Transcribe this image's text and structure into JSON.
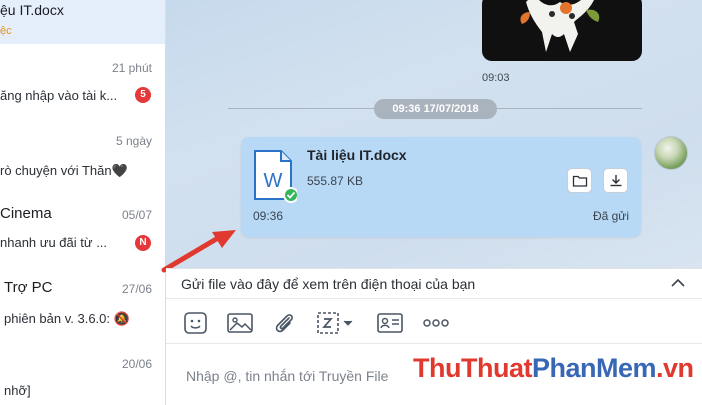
{
  "conversations": [
    {
      "name": "",
      "time": "",
      "preview": "ệu IT.docx",
      "sub": "ệc",
      "badge": ""
    },
    {
      "name": "",
      "time": "21 phút",
      "preview": "ăng nhập vào tài k...",
      "sub": "",
      "badge": "5"
    },
    {
      "name": "",
      "time": "5 ngày",
      "preview": "rò chuyện với Thăn🖤",
      "sub": "",
      "badge": ""
    },
    {
      "name": "Cinema",
      "time": "05/07",
      "preview": "nhanh ưu đãi từ ...",
      "sub": "",
      "badge": "N"
    },
    {
      "name": "Trợ PC",
      "time": "27/06",
      "preview": "phiên bản v. 3.6.0: 🔕",
      "sub": "",
      "badge": ""
    },
    {
      "name": "",
      "time": "20/06",
      "preview": "nhỡ]",
      "sub": "",
      "badge": ""
    }
  ],
  "chat": {
    "sticker_time": "09:03",
    "date_separator": "09:36 17/07/2018",
    "file_message": {
      "file_name": "Tài liệu IT.docx",
      "file_size": "555.87 KB",
      "time": "09:36",
      "status": "Đã gửi",
      "doc_letter": "W"
    }
  },
  "send_tip": {
    "text": "Gửi file vào đây để xem trên điện thoại của bạn"
  },
  "toolbar": {
    "more_label": "ooo"
  },
  "composer": {
    "placeholder": "Nhập @, tin nhắn tới Truyền File"
  },
  "watermark": {
    "part1": "ThuThuat",
    "part2": "PhanMem",
    "part3": ".vn"
  },
  "colors": {
    "accent_blue": "#0068ff",
    "bubble": "#b7d9f5",
    "badge_red": "#e5383b",
    "arrow_red": "#e0392f",
    "watermark_blue": "#3867b6"
  }
}
